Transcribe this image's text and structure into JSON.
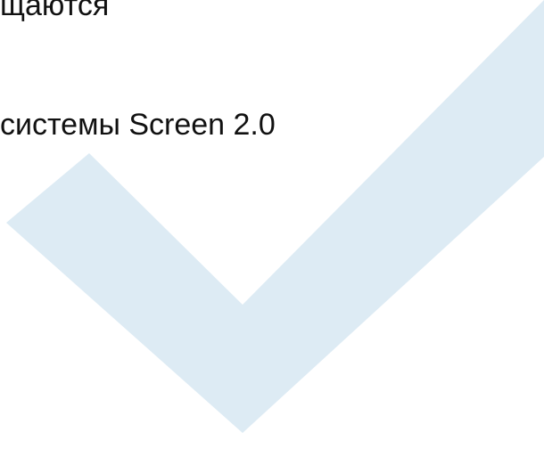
{
  "document": {
    "line_1": "щаются",
    "line_2": "системы Screen 2.0"
  },
  "watermark": {
    "icon": "checkmark-icon",
    "color": "#ddebf4"
  }
}
